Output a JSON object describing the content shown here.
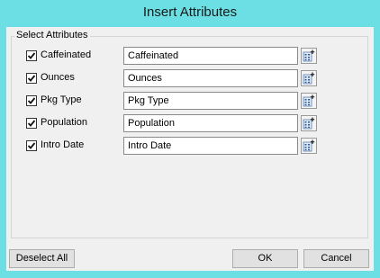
{
  "window": {
    "title": "Insert Attributes"
  },
  "group": {
    "label": "Select Attributes"
  },
  "attributes": [
    {
      "checked": true,
      "label": "Caffeinated",
      "value": "Caffeinated"
    },
    {
      "checked": true,
      "label": "Ounces",
      "value": "Ounces"
    },
    {
      "checked": true,
      "label": "Pkg Type",
      "value": "Pkg Type"
    },
    {
      "checked": true,
      "label": "Population",
      "value": "Population"
    },
    {
      "checked": true,
      "label": "Intro Date",
      "value": "Intro Date"
    }
  ],
  "buttons": {
    "deselect_all": "Deselect All",
    "ok": "OK",
    "cancel": "Cancel"
  },
  "icons": {
    "checkbox_check": "check-icon",
    "picker": "attribute-picker-icon"
  },
  "colors": {
    "window_frame": "#6cdfe4",
    "client_bg": "#f0f0f0",
    "button_bg": "#e1e1e1"
  }
}
